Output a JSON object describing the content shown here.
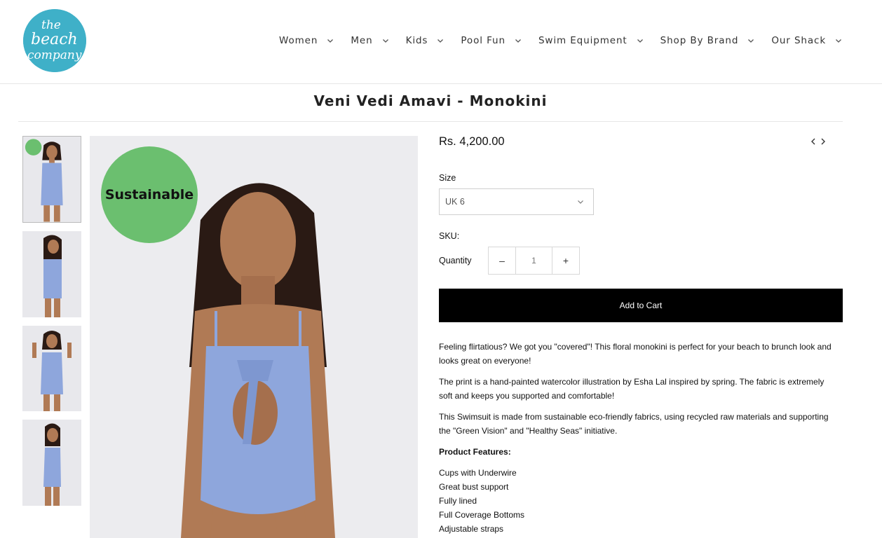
{
  "brand": {
    "logo_lines": [
      "the",
      "beach",
      "company"
    ],
    "logo_color": "#3fb0c8"
  },
  "nav": {
    "items": [
      {
        "label": "Women"
      },
      {
        "label": "Men"
      },
      {
        "label": "Kids"
      },
      {
        "label": "Pool Fun"
      },
      {
        "label": "Swim Equipment"
      },
      {
        "label": "Shop By Brand"
      },
      {
        "label": "Our Shack"
      }
    ]
  },
  "product": {
    "title": "Veni Vedi Amavi - Monokini",
    "price": "Rs. 4,200.00",
    "badge": "Sustainable",
    "size_label": "Size",
    "size_value": "UK 6",
    "sku_label": "SKU:",
    "quantity_label": "Quantity",
    "quantity_value": "1",
    "minus": "–",
    "plus": "+",
    "add_to_cart": "Add to Cart",
    "description": [
      "Feeling flirtatious? We got you \"covered\"! This floral monokini is perfect for your beach to brunch look and looks great on everyone!",
      "The print is a hand-painted watercolor illustration by Esha Lal inspired by spring. The fabric is extremely soft and keeps you supported and comfortable!",
      "This Swimsuit is made from sustainable eco-friendly fabrics, using recycled raw materials and supporting the \"Green Vision\" and \"Healthy Seas\" initiative."
    ],
    "features_title": "Product Features:",
    "features": [
      "Cups with Underwire",
      "Great bust support",
      "Fully lined",
      "Full Coverage Bottoms",
      "Adjustable straps"
    ]
  },
  "icons": {
    "nav_chevron": "chevron-down-icon",
    "prev": "chevron-left-icon",
    "next": "chevron-right-icon"
  },
  "colors": {
    "badge": "#6bbf6f",
    "swimsuit": "#8ea6dc",
    "cart_button": "#000000"
  }
}
